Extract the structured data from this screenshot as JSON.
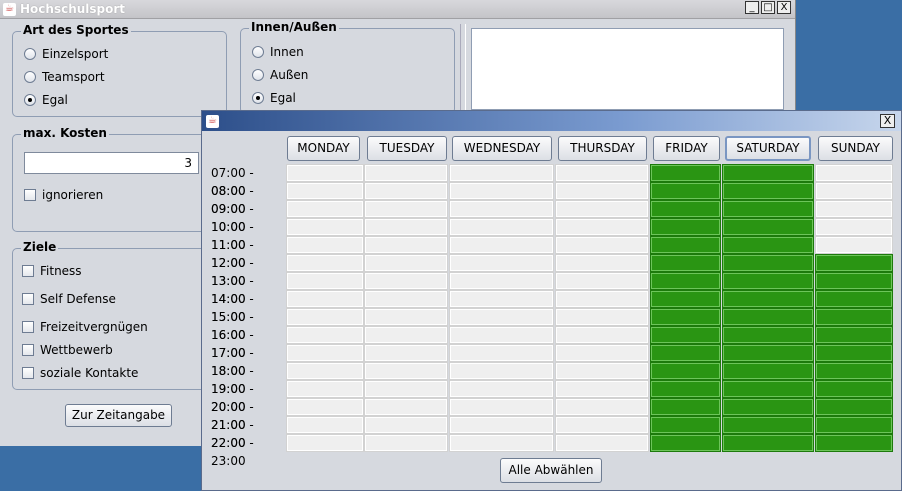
{
  "main_window": {
    "title": "Hochschulsport",
    "controls": [
      "_",
      "□",
      "X"
    ]
  },
  "sport_type": {
    "label": "Art des Sportes",
    "options": [
      "Einzelsport",
      "Teamsport",
      "Egal"
    ],
    "selected": "Egal"
  },
  "inout": {
    "label": "Innen/Außen",
    "options": [
      "Innen",
      "Außen",
      "Egal"
    ],
    "selected": "Egal"
  },
  "costs": {
    "label": "max. Kosten",
    "value": "3",
    "ignore_label": "ignorieren"
  },
  "goals": {
    "label": "Ziele",
    "items": [
      "Fitness",
      "Self Defense",
      "Freizeitvergnügen",
      "Wettbewerb",
      "soziale Kontakte"
    ]
  },
  "to_time_button": "Zur Zeitangabe",
  "dialog": {
    "close": "X",
    "days": [
      "MONDAY",
      "TUESDAY",
      "WEDNESDAY",
      "THURSDAY",
      "FRIDAY",
      "SATURDAY",
      "SUNDAY"
    ],
    "focused_day": "SATURDAY",
    "times": [
      "07:00 - 08:00",
      "08:00 - 09:00",
      "09:00 - 10:00",
      "10:00 - 11:00",
      "11:00 - 12:00",
      "12:00 - 13:00",
      "13:00 - 14:00",
      "14:00 - 15:00",
      "15:00 - 16:00",
      "16:00 - 17:00",
      "17:00 - 18:00",
      "18:00 - 19:00",
      "19:00 - 20:00",
      "20:00 - 21:00",
      "21:00 - 22:00",
      "22:00 - 23:00"
    ],
    "selected": {
      "FRIDAY": "all",
      "SATURDAY": "all",
      "SUNDAY": "12:00 - 13:00 onward"
    },
    "grid": [
      [
        0,
        0,
        0,
        0,
        1,
        1,
        0
      ],
      [
        0,
        0,
        0,
        0,
        1,
        1,
        0
      ],
      [
        0,
        0,
        0,
        0,
        1,
        1,
        0
      ],
      [
        0,
        0,
        0,
        0,
        1,
        1,
        0
      ],
      [
        0,
        0,
        0,
        0,
        1,
        1,
        0
      ],
      [
        0,
        0,
        0,
        0,
        1,
        1,
        1
      ],
      [
        0,
        0,
        0,
        0,
        1,
        1,
        1
      ],
      [
        0,
        0,
        0,
        0,
        1,
        1,
        1
      ],
      [
        0,
        0,
        0,
        0,
        1,
        1,
        1
      ],
      [
        0,
        0,
        0,
        0,
        1,
        1,
        1
      ],
      [
        0,
        0,
        0,
        0,
        1,
        1,
        1
      ],
      [
        0,
        0,
        0,
        0,
        1,
        1,
        1
      ],
      [
        0,
        0,
        0,
        0,
        1,
        1,
        1
      ],
      [
        0,
        0,
        0,
        0,
        1,
        1,
        1
      ],
      [
        0,
        0,
        0,
        0,
        1,
        1,
        1
      ],
      [
        0,
        0,
        0,
        0,
        1,
        1,
        1
      ]
    ],
    "deselect_all": "Alle Abwählen"
  },
  "colors": {
    "selected_cell": "#2a9513",
    "empty_cell": "#efefef",
    "window_bg": "#d6d9df",
    "desktop": "#3a6ea5"
  }
}
